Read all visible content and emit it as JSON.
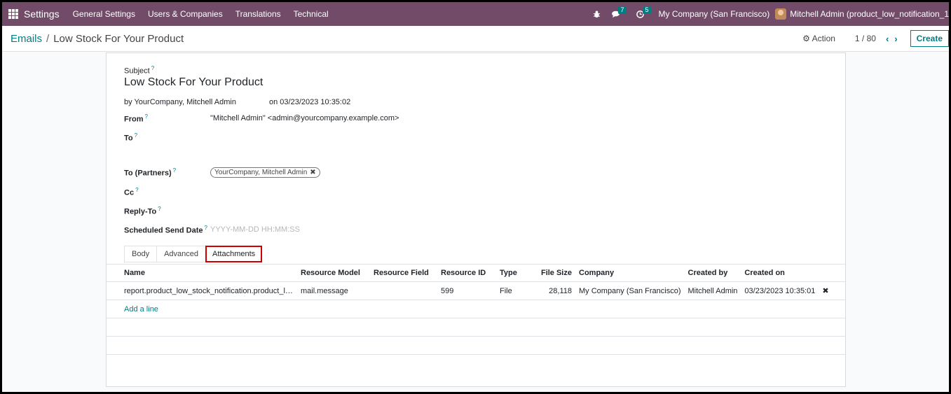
{
  "navbar": {
    "app_name": "Settings",
    "menu": [
      "General Settings",
      "Users & Companies",
      "Translations",
      "Technical"
    ],
    "messages_count": "7",
    "activities_count": "5",
    "company": "My Company (San Francisco)",
    "user": "Mitchell Admin (product_low_notification_1"
  },
  "control": {
    "breadcrumb_parent": "Emails",
    "breadcrumb_current": "Low Stock For Your Product",
    "action_label": "Action",
    "pager": "1 / 80",
    "create_label": "Create"
  },
  "form": {
    "subject_label": "Subject",
    "subject": "Low Stock For Your Product",
    "by_line": "by YourCompany, Mitchell Admin",
    "date_line": "on 03/23/2023 10:35:02",
    "from_label": "From",
    "from_value": "\"Mitchell Admin\" <admin@yourcompany.example.com>",
    "to_label": "To",
    "to_partners_label": "To (Partners)",
    "partner_tag": "YourCompany, Mitchell Admin",
    "cc_label": "Cc",
    "reply_to_label": "Reply-To",
    "scheduled_label": "Scheduled Send Date",
    "scheduled_placeholder": "YYYY-MM-DD HH:MM:SS",
    "help_mark": "?"
  },
  "tabs": [
    "Body",
    "Advanced",
    "Attachments"
  ],
  "attachments": {
    "columns": [
      "Name",
      "Resource Model",
      "Resource Field",
      "Resource ID",
      "Type",
      "File Size",
      "Company",
      "Created by",
      "Created on"
    ],
    "rows": [
      [
        "report.product_low_stock_notification.product_low_s...",
        "mail.message",
        "",
        "599",
        "File",
        "28,118",
        "My Company (San Francisco)",
        "Mitchell Admin",
        "03/23/2023 10:35:01"
      ]
    ],
    "add_line": "Add a line"
  },
  "colors": {
    "navbar": "#714b67",
    "accent": "#017e84",
    "highlight": "#d00000"
  }
}
